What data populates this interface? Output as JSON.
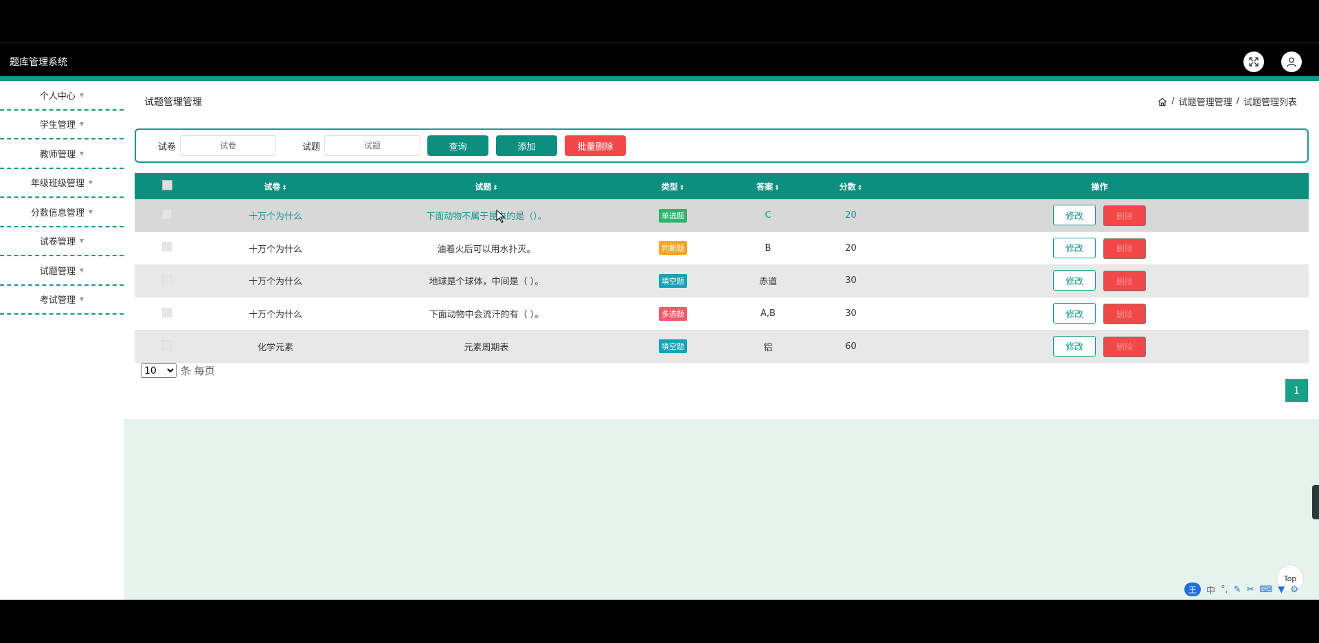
{
  "app": {
    "title": "题库管理系统"
  },
  "sidebar": {
    "items": [
      {
        "label": "个人中心"
      },
      {
        "label": "学生管理"
      },
      {
        "label": "教师管理"
      },
      {
        "label": "年级班级管理"
      },
      {
        "label": "分数信息管理"
      },
      {
        "label": "试卷管理"
      },
      {
        "label": "试题管理"
      },
      {
        "label": "考试管理"
      }
    ]
  },
  "page": {
    "title": "试题管理管理",
    "breadcrumb": [
      "试题管理管理",
      "试题管理列表"
    ],
    "separator": "/"
  },
  "search": {
    "paper_label": "试卷",
    "paper_placeholder": "试卷",
    "question_label": "试题",
    "question_placeholder": "试题",
    "query_button": "查询",
    "add_button": "添加",
    "batch_delete_button": "批量删除"
  },
  "table": {
    "columns": [
      "试卷",
      "试题",
      "类型",
      "答案",
      "分数",
      "操作"
    ],
    "sort_glyph": "⇕",
    "edit_label": "修改",
    "delete_label": "删除",
    "rows": [
      {
        "paper": "十万个为什么",
        "question": "下面动物不属于昆虫的是（）。",
        "type": "单选题",
        "type_color": "#2fb36b",
        "answer": "C",
        "score": "20"
      },
      {
        "paper": "十万个为什么",
        "question": "油着火后可以用水扑灭。",
        "type": "判断题",
        "type_color": "#f5a623",
        "answer": "B",
        "score": "20"
      },
      {
        "paper": "十万个为什么",
        "question": "地球是个球体，中间是（ ）。",
        "type": "填空题",
        "type_color": "#17a2b8",
        "answer": "赤道",
        "score": "30"
      },
      {
        "paper": "十万个为什么",
        "question": "下面动物中会流汗的有（ ）。",
        "type": "多选题",
        "type_color": "#f05a6a",
        "answer": "A,B",
        "score": "30"
      },
      {
        "paper": "化学元素",
        "question": "元素周期表",
        "type": "填空题",
        "type_color": "#17a2b8",
        "answer": "铝",
        "score": "60"
      }
    ]
  },
  "pagination": {
    "page_size": "10",
    "per_page_text": "条 每页",
    "current_page": "1"
  },
  "misc": {
    "top_button": "Top",
    "ime_text": "中",
    "ime_logo": "王"
  },
  "colors": {
    "accent": "#139a8a",
    "danger": "#f24848",
    "lower_bg": "#e6f2ec"
  }
}
